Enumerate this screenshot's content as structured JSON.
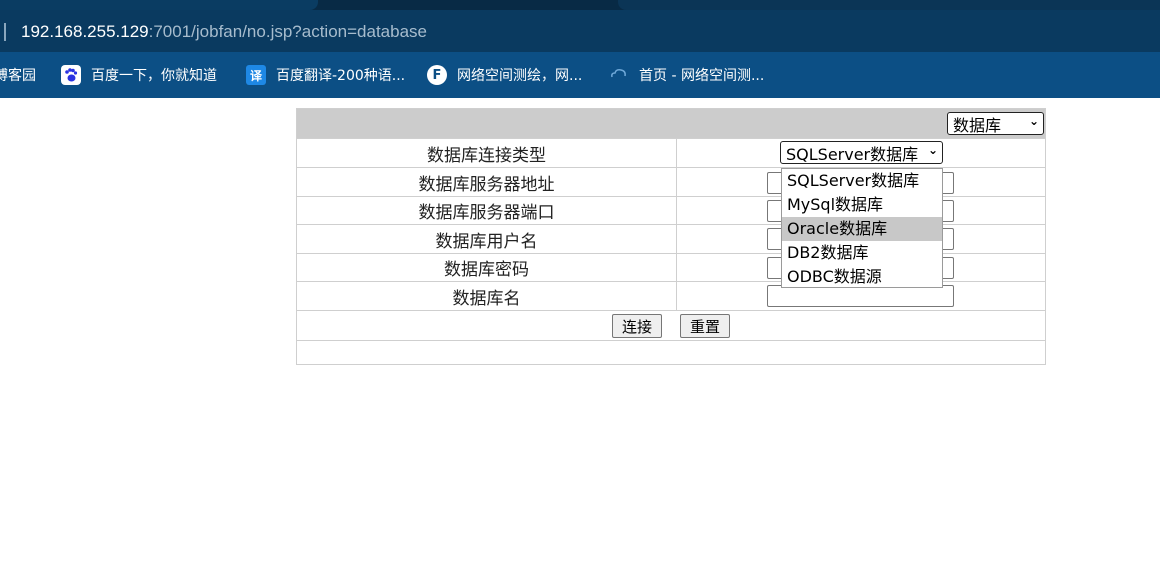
{
  "browser": {
    "url_host": "192.168.255.129",
    "url_path": ":7001/jobfan/no.jsp?action=database"
  },
  "bookmarks": [
    {
      "label": "博客园",
      "icon": "none"
    },
    {
      "label": "百度一下，你就知道",
      "icon": "baidu-paw-icon"
    },
    {
      "label": "百度翻译-200种语...",
      "icon": "translate-icon",
      "glyph": "译"
    },
    {
      "label": "网络空间测绘，网...",
      "icon": "fofa-icon",
      "glyph": "F"
    },
    {
      "label": "首页 - 网络空间测...",
      "icon": "cloud-icon"
    }
  ],
  "form": {
    "mode_select": "数据库",
    "labels": {
      "type": "数据库连接类型",
      "server": "数据库服务器地址",
      "port": "数据库服务器端口",
      "user": "数据库用户名",
      "password": "数据库密码",
      "dbname": "数据库名"
    },
    "type_select": "SQLServer数据库",
    "buttons": {
      "connect": "连接",
      "reset": "重置"
    }
  },
  "dropdown": {
    "options": [
      "SQLServer数据库",
      "MySql数据库",
      "Oracle数据库",
      "DB2数据库",
      "ODBC数据源"
    ],
    "highlighted": "Oracle数据库"
  },
  "colors": {
    "chrome_dark": "#082a45",
    "address_bar": "#0a3a60",
    "bookmarks_bar": "#0c4f85",
    "table_header": "#cccccc",
    "highlight": "#c8c8c8"
  }
}
